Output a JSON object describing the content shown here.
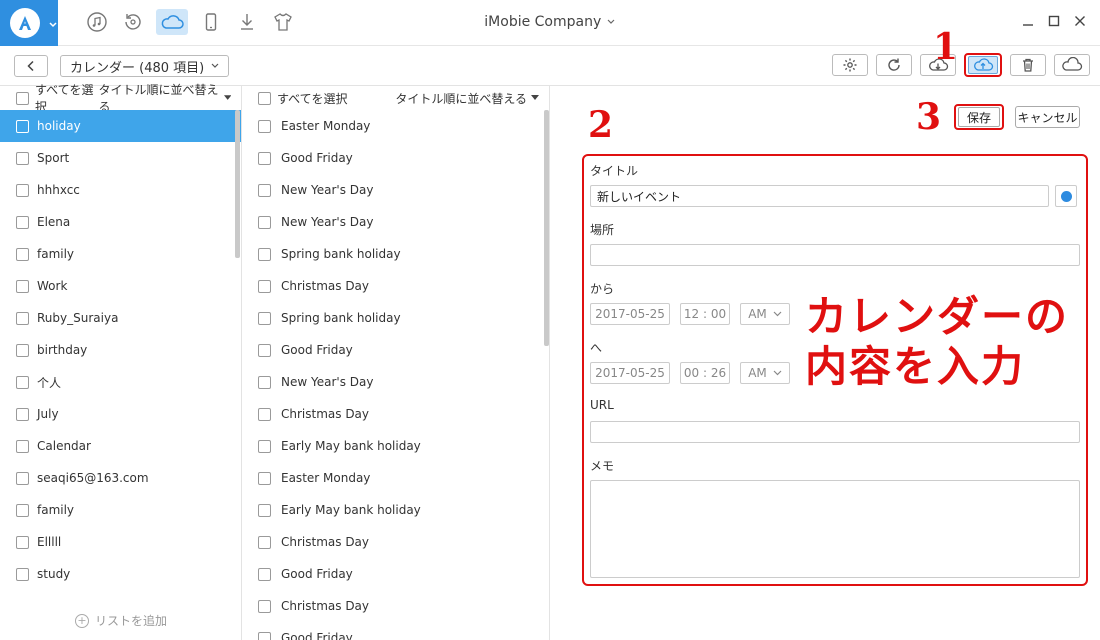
{
  "window": {
    "title": "iMobie Company",
    "nav_icons": [
      "music-icon",
      "restore-icon",
      "icloud-icon",
      "phone-icon",
      "download-icon",
      "tshirt-icon"
    ]
  },
  "toolbar": {
    "calendar_select": "カレンダー (480 項目)",
    "buttons": [
      "settings-icon",
      "refresh-icon",
      "cloud-download-icon",
      "cloud-upload-icon",
      "trash-icon",
      "cloud-icon"
    ]
  },
  "calendars": {
    "select_all": "すべてを選択",
    "sort": "タイトル順に並べ替える",
    "items": [
      "holiday",
      "Sport",
      "hhhxcc",
      "Elena",
      "family",
      "Work",
      "Ruby_Suraiya",
      "birthday",
      "个人",
      "July",
      "Calendar",
      "seaqi65@163.com",
      "family",
      "Elllll",
      "study"
    ],
    "selected_index": 0,
    "add_list": "リストを追加"
  },
  "events": {
    "select_all": "すべてを選択",
    "sort": "タイトル順に並べ替える",
    "items": [
      "Easter Monday",
      "Good Friday",
      "New Year's Day",
      "New Year's Day",
      "Spring bank holiday",
      "Christmas Day",
      "Spring bank holiday",
      "Good Friday",
      "New Year's Day",
      "Christmas Day",
      "Early May bank holiday",
      "Easter Monday",
      "Early May bank holiday",
      "Christmas Day",
      "Good Friday",
      "Christmas Day",
      "Good Friday"
    ]
  },
  "form": {
    "save": "保存",
    "cancel": "キャンセル",
    "title_label": "タイトル",
    "title_value": "新しいイベント",
    "location_label": "場所",
    "from_label": "から",
    "from_date": "2017-05-25",
    "from_time": "12 : 00",
    "from_ampm": "AM",
    "to_label": "へ",
    "to_date": "2017-05-25",
    "to_time": "00 : 26",
    "to_ampm": "AM",
    "url_label": "URL",
    "memo_label": "メモ",
    "accent_color": "#2d8be0"
  },
  "annotations": {
    "step1": "1",
    "step2": "2",
    "step3": "3",
    "line1": "カレンダーの",
    "line2": "内容を入力",
    "color": "#e01010"
  }
}
